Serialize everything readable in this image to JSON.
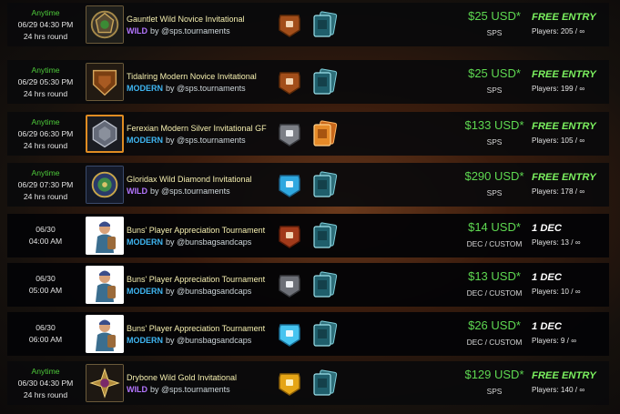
{
  "tournaments": [
    {
      "start_label": "Anytime",
      "datetime": "06/29 04:30 PM",
      "duration": "24 hrs round",
      "name": "Gauntlet Wild Novice Invitational",
      "format": "WILD",
      "by": "by @sps.tournaments",
      "thumb_icon": "gauntlet-emblem-icon",
      "league_icon": "bronze-league-icon",
      "deck_icon": "card-deck-icon",
      "prize_amount": "$25 USD*",
      "prize_currency": "SPS",
      "entry": "FREE ENTRY",
      "players": "Players: 205 / ∞"
    },
    {
      "start_label": "Anytime",
      "datetime": "06/29 05:30 PM",
      "duration": "24 hrs round",
      "name": "Tidalring Modern Novice Invitational",
      "format": "MODERN",
      "by": "by @sps.tournaments",
      "thumb_icon": "tidalring-emblem-icon",
      "league_icon": "bronze-league-icon",
      "deck_icon": "card-deck-icon",
      "prize_amount": "$25 USD*",
      "prize_currency": "SPS",
      "entry": "FREE ENTRY",
      "players": "Players: 199 / ∞"
    },
    {
      "start_label": "Anytime",
      "datetime": "06/29 06:30 PM",
      "duration": "24 hrs round",
      "name": "Ferexian Modern Silver Invitational GF",
      "format": "MODERN",
      "by": "by @sps.tournaments",
      "thumb_icon": "ferexian-emblem-icon",
      "league_icon": "silver-league-icon",
      "deck_icon": "gold-card-deck-icon",
      "prize_amount": "$133 USD*",
      "prize_currency": "SPS",
      "entry": "FREE ENTRY",
      "players": "Players: 105 / ∞"
    },
    {
      "start_label": "Anytime",
      "datetime": "06/29 07:30 PM",
      "duration": "24 hrs round",
      "name": "Gloridax Wild Diamond Invitational",
      "format": "WILD",
      "by": "by @sps.tournaments",
      "thumb_icon": "gloridax-emblem-icon",
      "league_icon": "diamond-league-icon",
      "deck_icon": "card-deck-icon",
      "prize_amount": "$290 USD*",
      "prize_currency": "SPS",
      "entry": "FREE ENTRY",
      "players": "Players: 178 / ∞"
    },
    {
      "start_label": "",
      "datetime": "06/30",
      "duration": "04:00 AM",
      "name": "Buns' Player Appreciation Tournament",
      "format": "MODERN",
      "by": "by @bunsbagsandcaps",
      "thumb_icon": "character-portrait-icon",
      "league_icon": "bronze-league-icon",
      "deck_icon": "card-deck-icon",
      "prize_amount": "$14 USD*",
      "prize_currency": "DEC / CUSTOM",
      "entry": "1 DEC",
      "players": "Players: 13 / ∞"
    },
    {
      "start_label": "",
      "datetime": "06/30",
      "duration": "05:00 AM",
      "name": "Buns' Player Appreciation Tournament",
      "format": "MODERN",
      "by": "by @bunsbagsandcaps",
      "thumb_icon": "character-portrait-icon",
      "league_icon": "silver-league-icon",
      "deck_icon": "card-deck-icon",
      "prize_amount": "$13 USD*",
      "prize_currency": "DEC / CUSTOM",
      "entry": "1 DEC",
      "players": "Players: 10 / ∞"
    },
    {
      "start_label": "",
      "datetime": "06/30",
      "duration": "06:00 AM",
      "name": "Buns' Player Appreciation Tournament",
      "format": "MODERN",
      "by": "by @bunsbagsandcaps",
      "thumb_icon": "character-portrait-icon",
      "league_icon": "diamond-league-icon",
      "deck_icon": "card-deck-icon",
      "prize_amount": "$26 USD*",
      "prize_currency": "DEC / CUSTOM",
      "entry": "1 DEC",
      "players": "Players: 9 / ∞"
    },
    {
      "start_label": "Anytime",
      "datetime": "06/30 04:30 PM",
      "duration": "24 hrs round",
      "name": "Drybone Wild Gold Invitational",
      "format": "WILD",
      "by": "by @sps.tournaments",
      "thumb_icon": "drybone-emblem-icon",
      "league_icon": "gold-league-icon",
      "deck_icon": "card-deck-icon",
      "prize_amount": "$129 USD*",
      "prize_currency": "SPS",
      "entry": "FREE ENTRY",
      "players": "Players: 140 / ∞"
    }
  ],
  "colors": {
    "anytime": "#4ecb3a",
    "prize": "#5ed851",
    "free_entry": "#7bf05f",
    "wild": "#b476ff",
    "modern": "#3fb6f2",
    "tournament_name": "#f6f0b0"
  }
}
